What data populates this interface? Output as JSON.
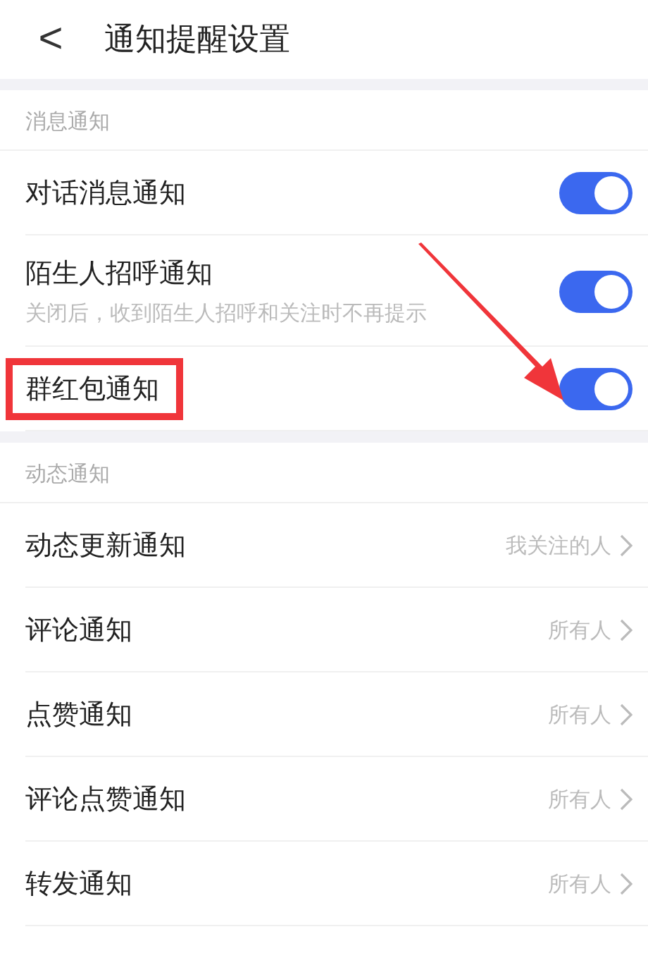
{
  "header": {
    "back": "<",
    "title": "通知提醒设置"
  },
  "sections": [
    {
      "label": "消息通知",
      "items": [
        {
          "kind": "toggle",
          "label": "对话消息通知",
          "on": true,
          "highlighted": false,
          "pointed": false
        },
        {
          "kind": "toggle",
          "label": "陌生人招呼通知",
          "description": "关闭后，收到陌生人招呼和关注时不再提示",
          "on": true,
          "highlighted": false,
          "pointed": false
        },
        {
          "kind": "toggle",
          "label": "群红包通知",
          "on": true,
          "highlighted": true,
          "pointed": true
        }
      ]
    },
    {
      "label": "动态通知",
      "items": [
        {
          "kind": "link",
          "label": "动态更新通知",
          "value": "我关注的人"
        },
        {
          "kind": "link",
          "label": "评论通知",
          "value": "所有人"
        },
        {
          "kind": "link",
          "label": "点赞通知",
          "value": "所有人"
        },
        {
          "kind": "link",
          "label": "评论点赞通知",
          "value": "所有人"
        },
        {
          "kind": "link",
          "label": "转发通知",
          "value": "所有人"
        }
      ]
    }
  ]
}
